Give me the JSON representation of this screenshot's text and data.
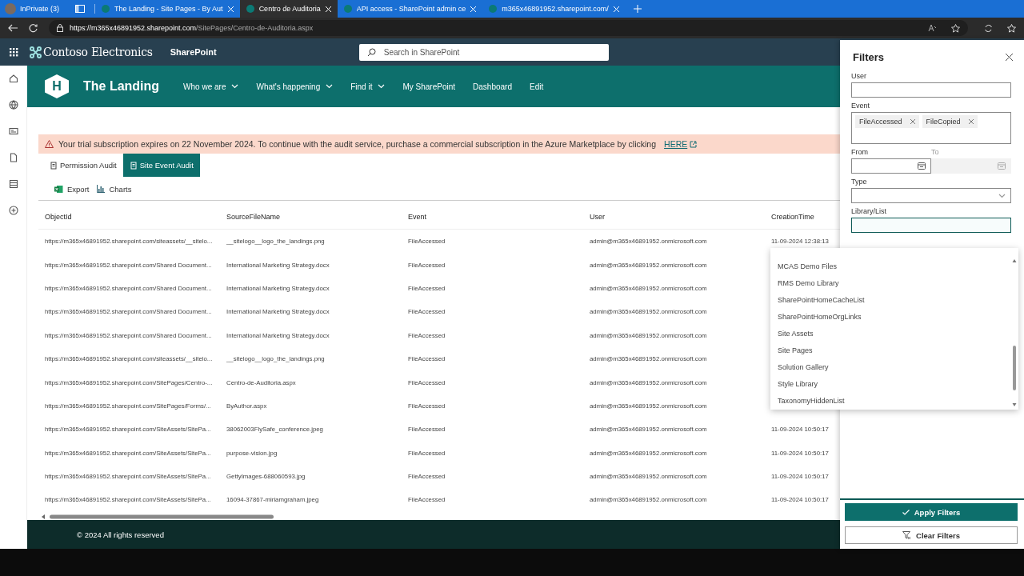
{
  "browser": {
    "profile": "InPrivate (3)",
    "tabs": [
      {
        "title": "The Landing - Site Pages - By Aut",
        "selected": false
      },
      {
        "title": "Centro de Auditoria",
        "selected": true
      },
      {
        "title": "API access - SharePoint admin ce",
        "selected": false
      },
      {
        "title": "m365x46891952.sharepoint.com/",
        "selected": false
      }
    ],
    "address": {
      "host": "https://m365x46891952.sharepoint.com",
      "path": "/SitePages/Centro-de-Auditoria.aspx"
    }
  },
  "suite": {
    "org": "Contoso Electronics",
    "app": "SharePoint",
    "search_placeholder": "Search in SharePoint"
  },
  "site": {
    "logo_letter": "H",
    "title": "The Landing",
    "nav": [
      {
        "label": "Who we are",
        "has_menu": true
      },
      {
        "label": "What's happening",
        "has_menu": true
      },
      {
        "label": "Find it",
        "has_menu": true
      },
      {
        "label": "My SharePoint",
        "has_menu": false
      },
      {
        "label": "Dashboard",
        "has_menu": false
      },
      {
        "label": "Edit",
        "has_menu": false
      }
    ]
  },
  "banner": {
    "text": "Your trial subscription expires on 22 November 2024. To continue with the audit service, purchase a commercial subscription in the Azure Marketplace by clicking",
    "link": "HERE"
  },
  "audit_tabs": [
    {
      "label": "Permission Audit",
      "selected": false
    },
    {
      "label": "Site Event Audit",
      "selected": true
    }
  ],
  "toolbar": [
    {
      "label": "Export",
      "kind": "excel"
    },
    {
      "label": "Charts",
      "kind": "chart"
    }
  ],
  "table": {
    "columns": [
      "ObjectId",
      "SourceFileName",
      "Event",
      "User",
      "CreationTime"
    ],
    "rows": [
      [
        "https://m365x46891952.sharepoint.com/siteassets/__sitelo...",
        "__sitelogo__logo_the_landings.png",
        "FileAccessed",
        "admin@m365x46891952.onmicrosoft.com",
        "11-09-2024 12:38:13"
      ],
      [
        "https://m365x46891952.sharepoint.com/Shared Document...",
        "International Marketing Strategy.docx",
        "FileAccessed",
        "admin@m365x46891952.onmicrosoft.com"
      ],
      [
        "https://m365x46891952.sharepoint.com/Shared Document...",
        "International Marketing Strategy.docx",
        "FileAccessed",
        "admin@m365x46891952.onmicrosoft.com"
      ],
      [
        "https://m365x46891952.sharepoint.com/Shared Document...",
        "International Marketing Strategy.docx",
        "FileAccessed",
        "admin@m365x46891952.onmicrosoft.com"
      ],
      [
        "https://m365x46891952.sharepoint.com/Shared Document...",
        "International Marketing Strategy.docx",
        "FileAccessed",
        "admin@m365x46891952.onmicrosoft.com"
      ],
      [
        "https://m365x46891952.sharepoint.com/siteassets/__sitelo...",
        "__sitelogo__logo_the_landings.png",
        "FileAccessed",
        "admin@m365x46891952.onmicrosoft.com"
      ],
      [
        "https://m365x46891952.sharepoint.com/SitePages/Centro-...",
        "Centro-de-Auditoria.aspx",
        "FileAccessed",
        "admin@m365x46891952.onmicrosoft.com"
      ],
      [
        "https://m365x46891952.sharepoint.com/SitePages/Forms/...",
        "ByAuthor.aspx",
        "FileAccessed",
        "admin@m365x46891952.onmicrosoft.com"
      ],
      [
        "https://m365x46891952.sharepoint.com/SiteAssets/SitePa...",
        "38062003FlySafe_conference.jpeg",
        "FileAccessed",
        "admin@m365x46891952.onmicrosoft.com",
        "11-09-2024 10:50:17"
      ],
      [
        "https://m365x46891952.sharepoint.com/SiteAssets/SitePa...",
        "purpose-vision.jpg",
        "FileAccessed",
        "admin@m365x46891952.onmicrosoft.com",
        "11-09-2024 10:50:17"
      ],
      [
        "https://m365x46891952.sharepoint.com/SiteAssets/SitePa...",
        "GettyImages-688060593.jpg",
        "FileAccessed",
        "admin@m365x46891952.onmicrosoft.com",
        "11-09-2024 10:50:17"
      ],
      [
        "https://m365x46891952.sharepoint.com/SiteAssets/SitePa...",
        "16094-37867-miriamgraham.jpeg",
        "FileAccessed",
        "admin@m365x46891952.onmicrosoft.com",
        "11-09-2024 10:50:17"
      ]
    ]
  },
  "footer": "© 2024 All rights reserved",
  "filters": {
    "title": "Filters",
    "fields": [
      {
        "kind": "text",
        "label": "User",
        "focused": false
      },
      {
        "kind": "tags",
        "label": "Event",
        "tags": [
          "FileAccessed",
          "FileCopied"
        ]
      },
      {
        "kind": "daterange",
        "label": "From",
        "label_to": "To",
        "to_disabled": true
      },
      {
        "kind": "select",
        "label": "Type"
      },
      {
        "kind": "text",
        "label": "Library/List",
        "focused": true
      }
    ],
    "options": [
      "MCAS Demo Files",
      "RMS Demo Library",
      "SharePointHomeCacheList",
      "SharePointHomeOrgLinks",
      "Site Assets",
      "Site Pages",
      "Solution Gallery",
      "Style Library",
      "TaxonomyHiddenList"
    ],
    "buttons": [
      {
        "label": "Apply Filters",
        "kind": "primary"
      },
      {
        "label": "Clear Filters",
        "kind": "secondary"
      }
    ]
  }
}
